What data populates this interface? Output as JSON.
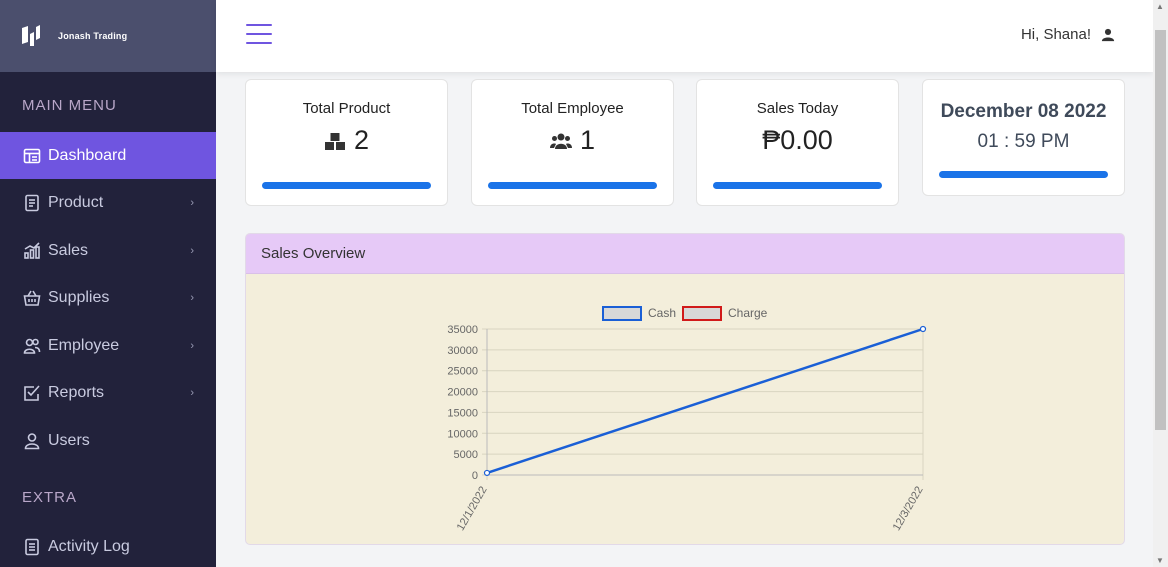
{
  "brand": {
    "name": "Jonash Trading"
  },
  "sidebar": {
    "main_heading": "MAIN MENU",
    "extra_heading": "EXTRA",
    "items": [
      {
        "label": "Dashboard",
        "icon": "dashboard-icon",
        "active": true
      },
      {
        "label": "Product",
        "icon": "document-icon",
        "submenu": true
      },
      {
        "label": "Sales",
        "icon": "bar-chart-icon",
        "submenu": true
      },
      {
        "label": "Supplies",
        "icon": "basket-icon",
        "submenu": true
      },
      {
        "label": "Employee",
        "icon": "people-icon",
        "submenu": true
      },
      {
        "label": "Reports",
        "icon": "checkbox-icon",
        "submenu": true
      },
      {
        "label": "Users",
        "icon": "user-icon"
      },
      {
        "label": "Activity Log",
        "icon": "log-icon"
      }
    ],
    "chevron": "›"
  },
  "header": {
    "greeting": "Hi,  Shana!"
  },
  "stats": {
    "total_product": {
      "title": "Total Product",
      "value": "2"
    },
    "total_employee": {
      "title": "Total Employee",
      "value": "1"
    },
    "sales_today": {
      "title": "Sales Today",
      "value": "₱0.00"
    },
    "date": "December 08 2022",
    "time": "01 : 59 PM"
  },
  "colors": {
    "accent": "#6f55e0",
    "bar": "#1a73e8",
    "cash": "#1a5fd6",
    "charge": "#d11a1a",
    "panel_header": "#e6c9f7",
    "panel_bg": "#f3eedb"
  },
  "panel": {
    "title": "Sales Overview"
  },
  "chart_data": {
    "type": "line",
    "x": [
      "12/1/2022",
      "12/3/2022"
    ],
    "series": [
      {
        "name": "Cash",
        "values": [
          500,
          35000
        ]
      },
      {
        "name": "Charge",
        "values": []
      }
    ],
    "ylim": [
      0,
      35000
    ],
    "yticks": [
      0,
      5000,
      10000,
      15000,
      20000,
      25000,
      30000,
      35000
    ],
    "grid": true,
    "legend": "top"
  }
}
